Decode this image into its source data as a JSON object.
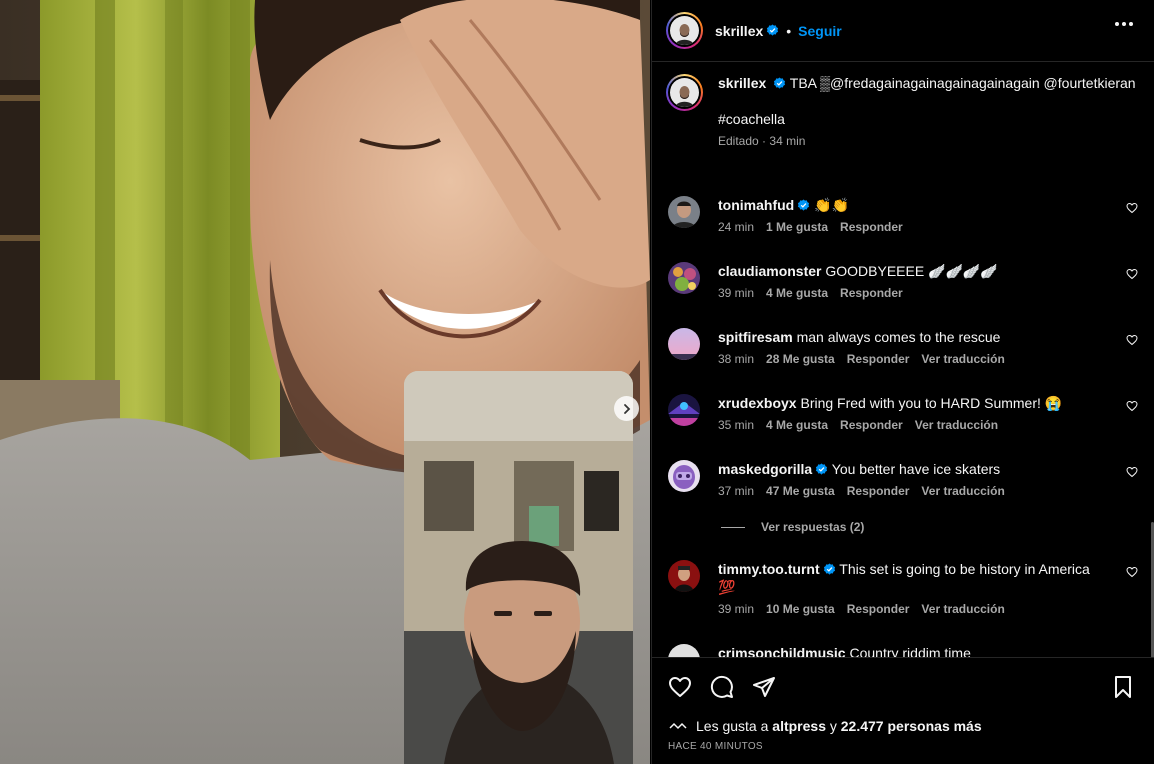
{
  "header": {
    "username": "skrillex",
    "follow_label": "Seguir"
  },
  "caption": {
    "username": "skrillex",
    "text": "TBA ▒@fredagainagainagainagainagain @fourtetkieran",
    "hashtag": "#coachella",
    "edited": "Editado",
    "time": "34 min"
  },
  "comments": [
    {
      "username": "tonimahfud",
      "verified": true,
      "text": "👏👏",
      "time": "24 min",
      "likes": "1 Me gusta",
      "reply": "Responder",
      "translate": ""
    },
    {
      "username": "claudiamonster",
      "verified": false,
      "text": "GOODBYEEEE 🪽🪽🪽🪽",
      "time": "39 min",
      "likes": "4 Me gusta",
      "reply": "Responder",
      "translate": ""
    },
    {
      "username": "spitfiresam",
      "verified": false,
      "text": "man always comes to the rescue",
      "time": "38 min",
      "likes": "28 Me gusta",
      "reply": "Responder",
      "translate": "Ver traducción"
    },
    {
      "username": "xrudexboyx",
      "verified": false,
      "text": "Bring Fred with you to HARD Summer! 😭",
      "time": "35 min",
      "likes": "4 Me gusta",
      "reply": "Responder",
      "translate": "Ver traducción"
    },
    {
      "username": "maskedgorilla",
      "verified": true,
      "text": "You better have ice skaters",
      "time": "37 min",
      "likes": "47 Me gusta",
      "reply": "Responder",
      "translate": "Ver traducción"
    },
    {
      "username": "timmy.too.turnt",
      "verified": true,
      "text": "This set is going to be history in America 💯",
      "time": "39 min",
      "likes": "10 Me gusta",
      "reply": "Responder",
      "translate": "Ver traducción"
    },
    {
      "username": "crimsonchildmusic",
      "verified": false,
      "text": "Country riddim time",
      "time": "",
      "likes": "",
      "reply": "",
      "translate": ""
    }
  ],
  "view_replies": "Ver respuestas (2)",
  "footer": {
    "likes_prefix": "Les gusta a",
    "likes_user": "altpress",
    "likes_joiner": "y",
    "likes_count": "22.477 personas más",
    "timestamp": "HACE 40 MINUTOS"
  },
  "icons": {
    "verified_color": "#0095f6",
    "action_icons": [
      "heart-icon",
      "comment-icon",
      "share-icon",
      "bookmark-icon"
    ],
    "header_icon": "more-options-icon",
    "media_icon": "chevron-right-icon"
  }
}
